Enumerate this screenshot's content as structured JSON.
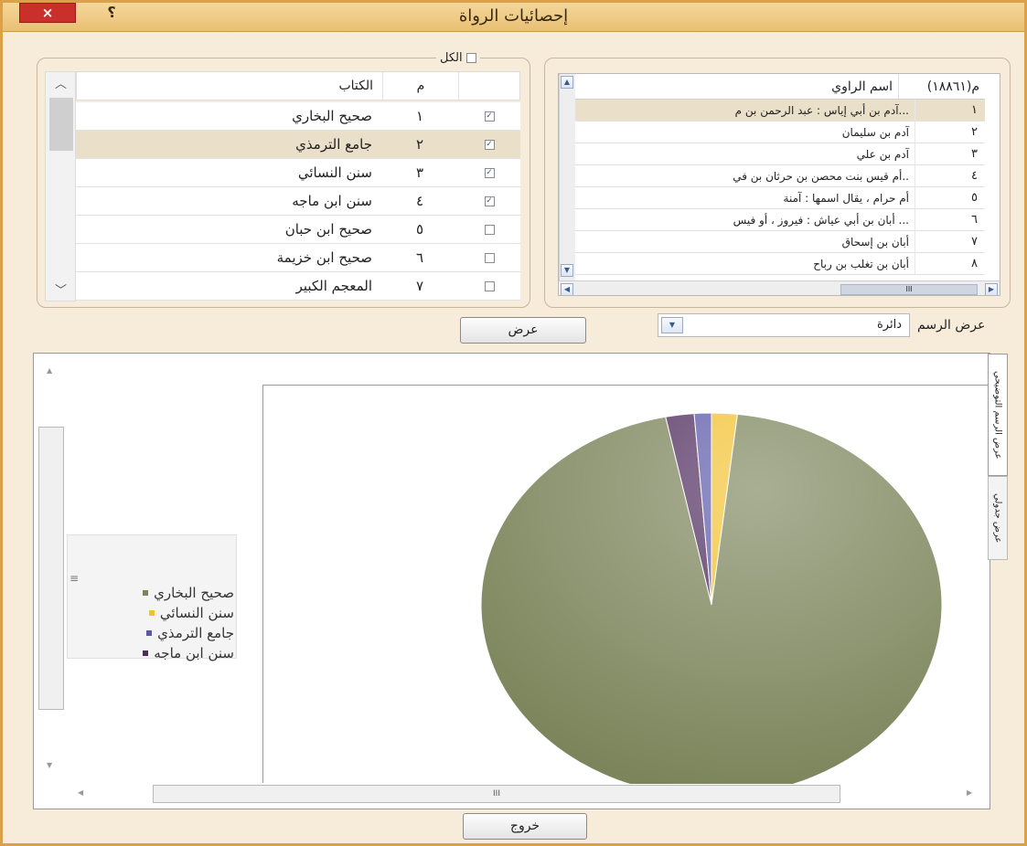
{
  "window": {
    "title": "إحصائيات الرواة",
    "close_label": "×",
    "help_label": "؟"
  },
  "narrators": {
    "col_index": "م(١٨٨٦١)",
    "col_name": "اسم الراوي",
    "rows": [
      {
        "n": "١",
        "name": "آدم بن أبي إياس : عبد الرحمن بن م..."
      },
      {
        "n": "٢",
        "name": "آدم بن سليمان"
      },
      {
        "n": "٣",
        "name": "آدم بن علي"
      },
      {
        "n": "٤",
        "name": "أم قيس بنت محصن بن حرثان بن في.."
      },
      {
        "n": "٥",
        "name": "أم حرام ، يقال اسمها : آمنة"
      },
      {
        "n": "٦",
        "name": "أبان بن أبي عياش : فيروز ، أو فيس ..."
      },
      {
        "n": "٧",
        "name": "أبان بن إسحاق"
      },
      {
        "n": "٨",
        "name": "أبان بن تغلب بن رباح"
      }
    ],
    "hscroll_thumb_label": "III"
  },
  "books": {
    "select_all_label": "الكل",
    "col_index": "م",
    "col_book": "الكتاب",
    "rows": [
      {
        "n": "١",
        "name": "صحيح البخاري",
        "checked": true
      },
      {
        "n": "٢",
        "name": "جامع الترمذي",
        "checked": true
      },
      {
        "n": "٣",
        "name": "سنن النسائي",
        "checked": true
      },
      {
        "n": "٤",
        "name": "سنن ابن ماجه",
        "checked": true
      },
      {
        "n": "٥",
        "name": "صحيح ابن حبان",
        "checked": false
      },
      {
        "n": "٦",
        "name": "صحيح ابن خزيمة",
        "checked": false
      },
      {
        "n": "٧",
        "name": "المعجم الكبير",
        "checked": false
      }
    ]
  },
  "controls": {
    "chart_type_label": "عرض الرسم",
    "chart_type_value": "دائرة",
    "show_button": "عرض",
    "exit_button": "خروج",
    "check_mark": "✓"
  },
  "tabs": {
    "graph": "عرض الرسم التوضيحي",
    "table": "عرض جدولي"
  },
  "chart_scroll": {
    "thumb_label": "III",
    "legend_grip": "≡"
  },
  "chart_data": {
    "type": "pie",
    "series": [
      {
        "name": "صحيح البخاري",
        "value": 95.0,
        "color": "#7b845a"
      },
      {
        "name": "سنن النسائي",
        "value": 1.8,
        "color": "#f2c12e"
      },
      {
        "name": "جامع الترمذي",
        "value": 1.2,
        "color": "#5b58a8"
      },
      {
        "name": "سنن ابن ماجه",
        "value": 2.0,
        "color": "#4f2c5e"
      }
    ],
    "legend_position": "left"
  }
}
